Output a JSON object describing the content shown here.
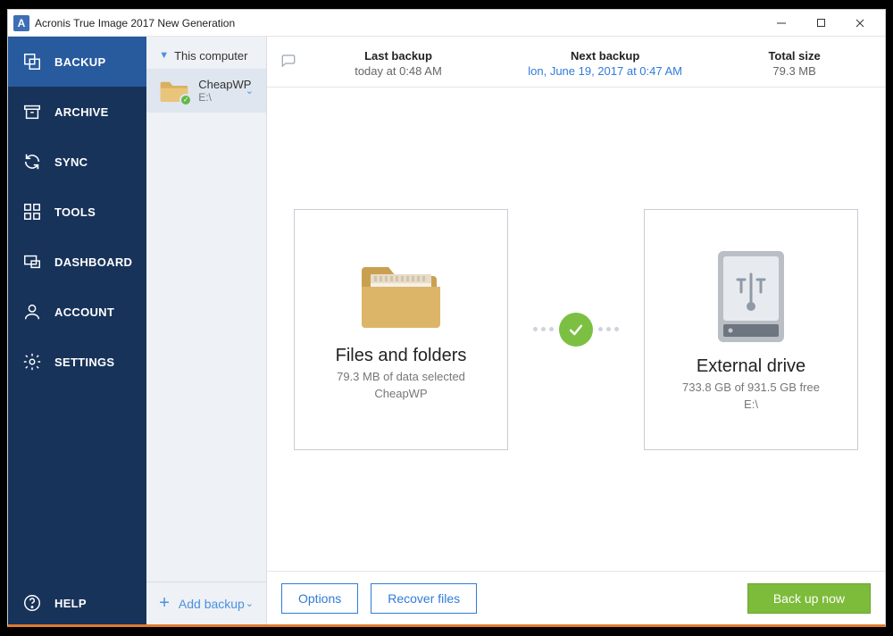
{
  "window": {
    "title": "Acronis True Image 2017 New Generation"
  },
  "sidebar": {
    "items": [
      {
        "label": "BACKUP"
      },
      {
        "label": "ARCHIVE"
      },
      {
        "label": "SYNC"
      },
      {
        "label": "TOOLS"
      },
      {
        "label": "DASHBOARD"
      },
      {
        "label": "ACCOUNT"
      },
      {
        "label": "SETTINGS"
      }
    ],
    "help": "HELP"
  },
  "backup_list": {
    "header": "This computer",
    "item": {
      "name": "CheapWP",
      "path": "E:\\"
    },
    "add_label": "Add backup"
  },
  "summary": {
    "last_backup": {
      "label": "Last backup",
      "value": "today at 0:48 AM"
    },
    "next_backup": {
      "label": "Next backup",
      "value": "lon, June 19, 2017 at 0:47 AM"
    },
    "total_size": {
      "label": "Total size",
      "value": "79.3 MB"
    }
  },
  "source": {
    "title": "Files and folders",
    "line1": "79.3 MB of data selected",
    "line2": "CheapWP"
  },
  "destination": {
    "title": "External drive",
    "line1": "733.8 GB of 931.5 GB free",
    "line2": "E:\\"
  },
  "footer": {
    "options": "Options",
    "recover": "Recover files",
    "backup_now": "Back up now"
  }
}
